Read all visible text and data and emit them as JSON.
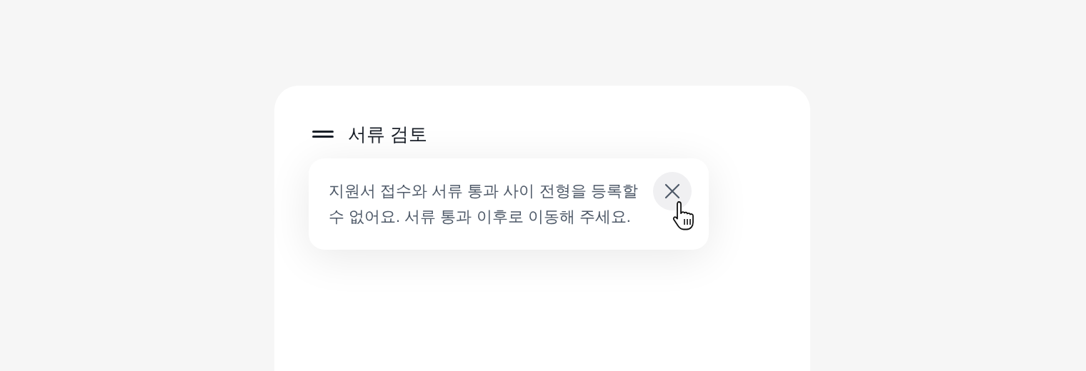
{
  "panel": {
    "title": "서류 검토"
  },
  "tooltip": {
    "message": "지원서 접수와 서류 통과 사이 전형을 등록할 수 없어요. 서류 통과 이후로 이동해 주세요.",
    "close_hovered": true
  }
}
